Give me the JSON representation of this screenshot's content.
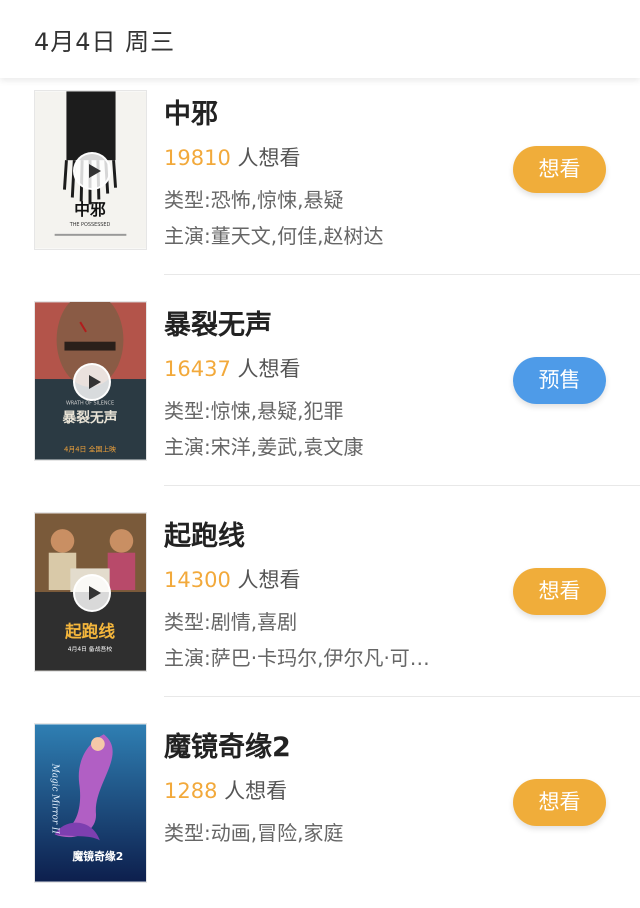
{
  "header": {
    "date": "4月4日 周三"
  },
  "wish_suffix": "人想看",
  "colors": {
    "accent": "#f0ad3a",
    "presale": "#4e9be8",
    "count": "#f2a93b"
  },
  "movies": [
    {
      "title": "中邪",
      "wish_count": "19810",
      "genre": "类型:恐怖,惊悚,悬疑",
      "cast": "主演:董天文,何佳,赵树达",
      "button": "想看",
      "poster_title": "中邪",
      "poster_subtitle": "THE POSSESSED"
    },
    {
      "title": "暴裂无声",
      "wish_count": "16437",
      "genre": "类型:惊悚,悬疑,犯罪",
      "cast": "主演:宋洋,姜武,袁文康",
      "button": "预售",
      "poster_title": "暴裂无声",
      "poster_subtitle": "WRATH OF SILENCE",
      "poster_date": "4月4日 全国上映"
    },
    {
      "title": "起跑线",
      "wish_count": "14300",
      "genre": "类型:剧情,喜剧",
      "cast": "主演:萨巴·卡玛尔,伊尔凡·可…",
      "button": "想看",
      "poster_title": "起跑线",
      "poster_date": "4月4日 备战吾校"
    },
    {
      "title": "魔镜奇缘2",
      "wish_count": "1288",
      "genre": "类型:动画,冒险,家庭",
      "button": "想看",
      "poster_title": "魔镜奇缘2",
      "poster_subtitle": "Magic Mirror II"
    }
  ]
}
